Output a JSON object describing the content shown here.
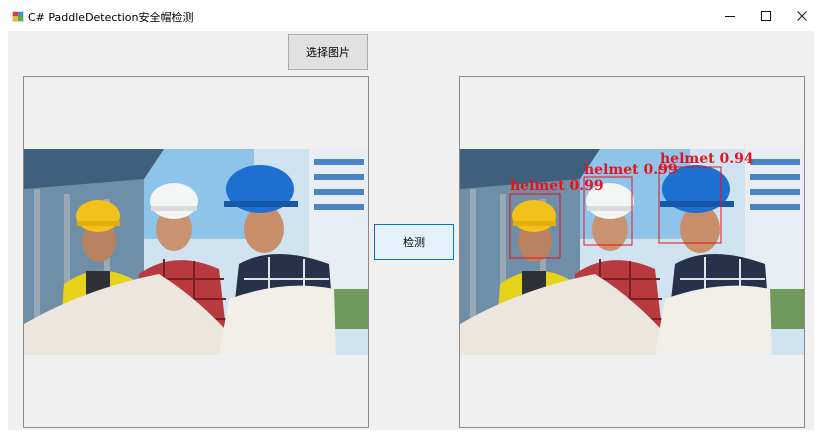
{
  "window": {
    "title": "C# PaddleDetection安全帽检测",
    "minimize_icon": "minimize-icon",
    "maximize_icon": "maximize-icon",
    "close_icon": "close-icon"
  },
  "toolbar": {
    "select_image_label": "选择图片",
    "detect_label": "检测"
  },
  "result": {
    "detections": [
      {
        "label": "helmet",
        "score": "0.99",
        "text": "helmet 0.99"
      },
      {
        "label": "helmet",
        "score": "0.99",
        "text": "helmet 0.99"
      },
      {
        "label": "helmet",
        "score": "0.94",
        "text": "helmet 0.94"
      }
    ],
    "box_color": "#e8121a"
  },
  "colors": {
    "window_bg": "#f0f0f0",
    "focus_border": "#0078d7"
  }
}
